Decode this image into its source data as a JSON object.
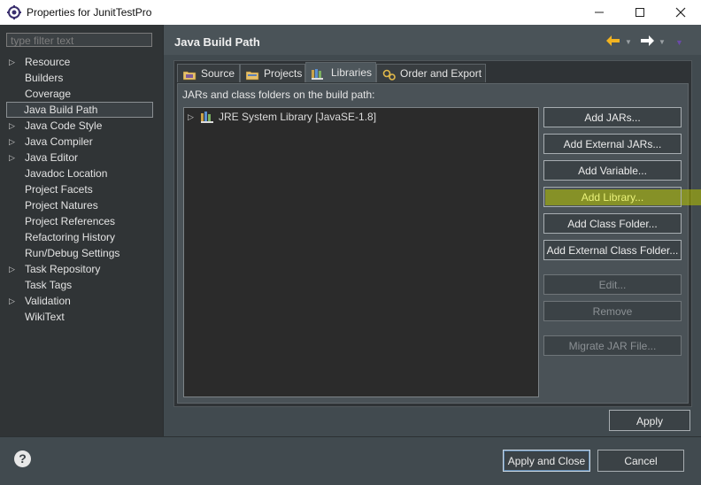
{
  "window": {
    "title": "Properties for JunitTestPro",
    "controls": [
      "minimize",
      "maximize",
      "close"
    ]
  },
  "sidebar": {
    "filter_placeholder": "type filter text",
    "items": [
      {
        "label": "Resource",
        "expandable": true
      },
      {
        "label": "Builders",
        "expandable": false
      },
      {
        "label": "Coverage",
        "expandable": false
      },
      {
        "label": "Java Build Path",
        "expandable": false,
        "selected": true
      },
      {
        "label": "Java Code Style",
        "expandable": true
      },
      {
        "label": "Java Compiler",
        "expandable": true
      },
      {
        "label": "Java Editor",
        "expandable": true
      },
      {
        "label": "Javadoc Location",
        "expandable": false
      },
      {
        "label": "Project Facets",
        "expandable": false
      },
      {
        "label": "Project Natures",
        "expandable": false
      },
      {
        "label": "Project References",
        "expandable": false
      },
      {
        "label": "Refactoring History",
        "expandable": false
      },
      {
        "label": "Run/Debug Settings",
        "expandable": false
      },
      {
        "label": "Task Repository",
        "expandable": true
      },
      {
        "label": "Task Tags",
        "expandable": false
      },
      {
        "label": "Validation",
        "expandable": true
      },
      {
        "label": "WikiText",
        "expandable": false
      }
    ]
  },
  "header": {
    "title": "Java Build Path"
  },
  "tabs": [
    {
      "label": "Source",
      "icon": "source-folder-icon"
    },
    {
      "label": "Projects",
      "icon": "projects-folder-icon"
    },
    {
      "label": "Libraries",
      "icon": "libraries-icon",
      "active": true
    },
    {
      "label": "Order and Export",
      "icon": "order-export-icon"
    }
  ],
  "libraries": {
    "caption": "JARs and class folders on the build path:",
    "entries": [
      {
        "label": "JRE System Library [JavaSE-1.8]",
        "icon": "jre-library-icon"
      }
    ]
  },
  "buttons": {
    "add_jars": "Add JARs...",
    "add_external_jars": "Add External JARs...",
    "add_variable": "Add Variable...",
    "add_library": "Add Library...",
    "add_class_folder": "Add Class Folder...",
    "add_external_class_folder": "Add External Class Folder...",
    "edit": "Edit...",
    "remove": "Remove",
    "migrate_jar": "Migrate JAR File..."
  },
  "footer": {
    "apply": "Apply",
    "apply_and_close": "Apply and Close",
    "cancel": "Cancel"
  },
  "colors": {
    "highlight": "#b8c400",
    "background": "#414a4f"
  }
}
